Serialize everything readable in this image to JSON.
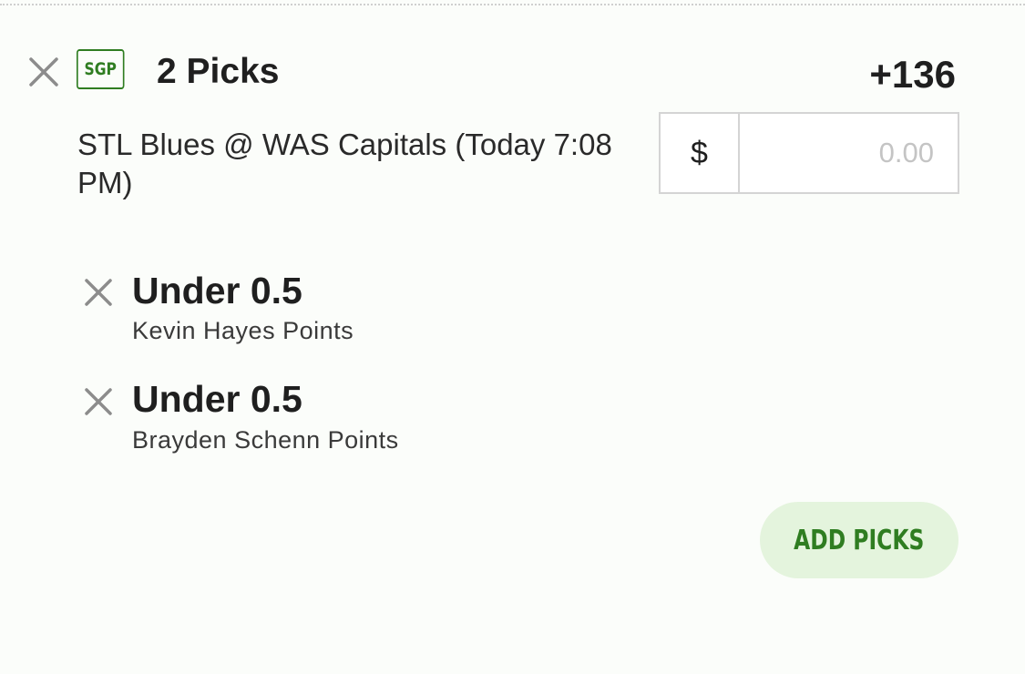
{
  "bet_slip": {
    "badge": "SGP",
    "title": "2 Picks",
    "odds": "+136",
    "matchup": "STL Blues @ WAS Capitals (Today 7:08 PM)",
    "stake": {
      "currency_symbol": "$",
      "value": "",
      "placeholder": "0.00"
    },
    "picks": [
      {
        "line": "Under 0.5",
        "description": "Kevin Hayes Points"
      },
      {
        "line": "Under 0.5",
        "description": "Brayden Schenn Points"
      }
    ],
    "add_picks_label": "ADD PICKS"
  },
  "icons": {
    "remove_slip": "close-icon",
    "remove_pick": "close-icon"
  },
  "colors": {
    "accent_green": "#2f7d21",
    "button_bg": "#e4f4dd",
    "background": "#fbfdfa",
    "icon_gray": "#8c8c8c",
    "placeholder_gray": "#c4c4c4"
  }
}
